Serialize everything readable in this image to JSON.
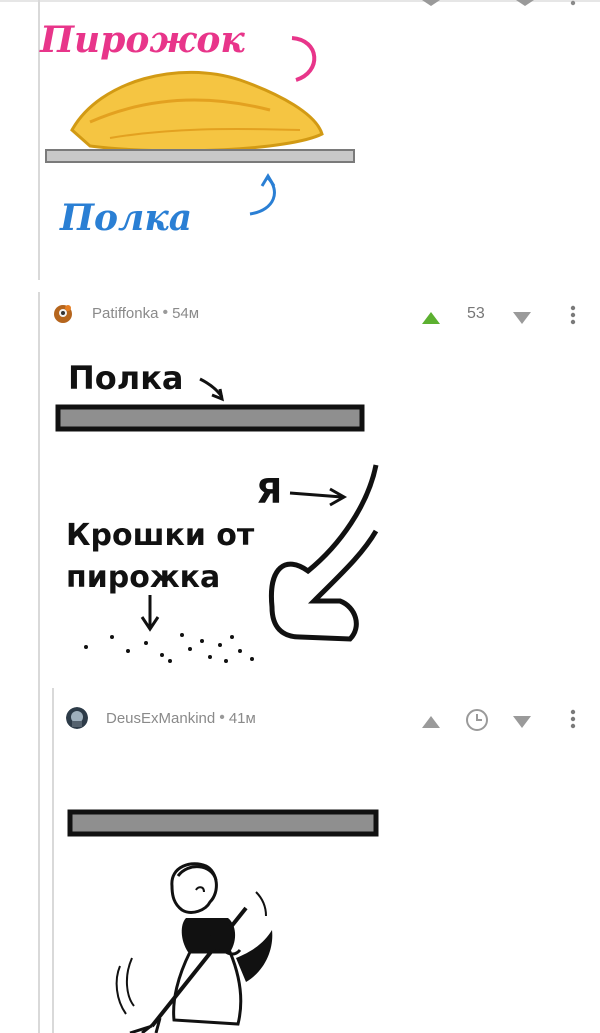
{
  "picture1": {
    "top_word": "Пирожок",
    "bottom_word": "Полка"
  },
  "comment1": {
    "author": "Patiffonka",
    "separator": "•",
    "time": "54м",
    "score": "53",
    "picture": {
      "shelf_word": "Полка",
      "crumbs_line1": "Крошки от",
      "crumbs_line2": "пирожка",
      "me_word": "Я"
    }
  },
  "comment2": {
    "author": "DeusExMankind",
    "separator": "•",
    "time": "41м"
  },
  "colors": {
    "upvote_active": "#5cb030",
    "vote_inactive": "#9a9a9a",
    "pirozhok_text": "#e8358a",
    "polka_text": "#2a7fd4"
  },
  "icons": [
    "upvote-icon",
    "downvote-icon",
    "more-vert-icon",
    "clock-icon"
  ]
}
